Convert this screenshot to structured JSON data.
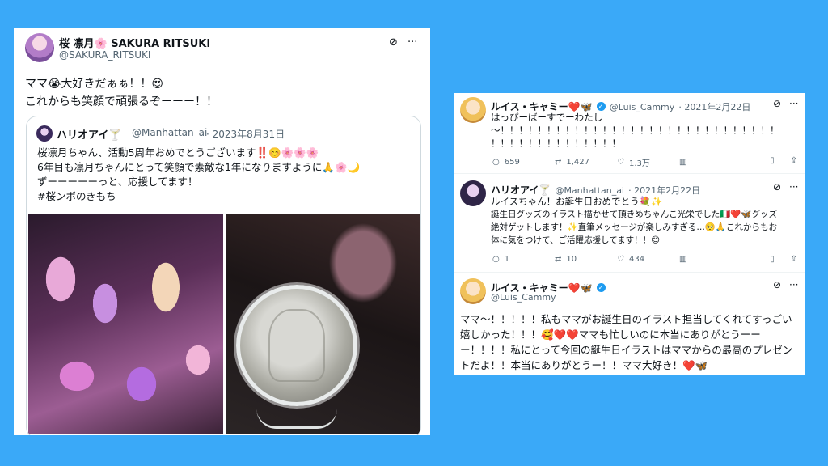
{
  "left_tweet": {
    "display_name": "桜 凛月🌸 SAKURA RITSUKI",
    "handle": "@SAKURA_RITSUKI",
    "text_line1": "ママ😭大好きだぁぁ！！😍",
    "text_line2": "これからも笑顔で頑張るぞーーー！！",
    "quote": {
      "display_name": "ハリオアイ🍸",
      "handle": "@Manhattan_ai",
      "date": "· 2023年8月31日",
      "line1": "桜凛月ちゃん、活動5周年おめでとうございます‼️☺️🌸🌸🌸",
      "line2": "6年目も凛月ちゃんにとって笑顔で素敵な1年になりますように🙏🌸🌙",
      "line3": "ずーーーーーっと、応援してます！",
      "line4": "#桜ンボのきもち"
    }
  },
  "right_thread": {
    "tweet1": {
      "display_name": "ルイス・キャミー❤️🦋",
      "handle": "@Luis_Cammy",
      "date": "· 2021年2月22日",
      "line1": "はっぴーばーすでーわたし",
      "line2": "〜！！！！！！！！！！！！！！！！！！！！！！！！！！！！！！",
      "line3": "！！！！！！！！！！！！！！",
      "replies": "659",
      "retweets": "1,427",
      "likes": "1.3万"
    },
    "tweet2": {
      "display_name": "ハリオアイ🍸",
      "handle": "@Manhattan_ai",
      "date": "· 2021年2月22日",
      "line1": "ルイスちゃん！お誕生日おめでとう💐✨",
      "line2": "誕生日グッズのイラスト描かせて頂きめちゃんこ光栄でした🇮🇹❤️🦋グッズ",
      "line3": "絶対ゲットします！✨直筆メッセージが楽しみすぎる…🥺🙏これからもお",
      "line4": "体に気をつけて、ご活躍応援してます！！😊",
      "replies": "1",
      "retweets": "10",
      "likes": "434"
    },
    "tweet3": {
      "display_name": "ルイス・キャミー❤️🦋",
      "handle": "@Luis_Cammy",
      "line1": "ママ〜！！！！！私もママがお誕生日のイラスト担当してくれてすっごい",
      "line2": "嬉しかった！！！🥰❤️❤️ママも忙しいのに本当にありがとうーー",
      "line3": "ー！！！！私にとって今回の誕生日イラストはママからの最高のプレゼン",
      "line4": "トだよ！！本当にありがとうー！！ママ大好き！❤️🦋"
    }
  },
  "icons": {
    "grok": "grok-icon",
    "more": "more-icon",
    "reply": "reply-icon",
    "retweet": "retweet-icon",
    "like": "like-icon",
    "views": "views-icon",
    "bookmark": "bookmark-icon",
    "share": "share-icon"
  },
  "colors": {
    "background": "#3aa9f8",
    "card": "#ffffff",
    "verified": "#1d9bf0",
    "secondary_text": "#536471"
  }
}
